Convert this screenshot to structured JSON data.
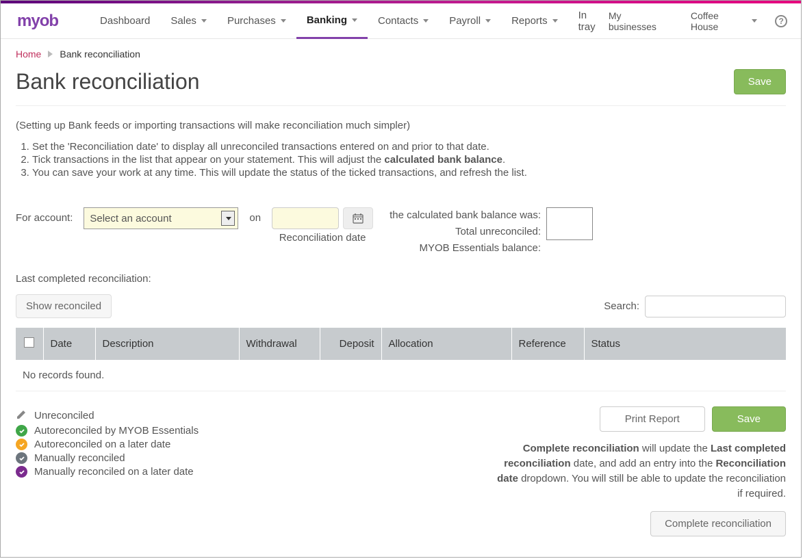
{
  "logo": "myob",
  "nav": {
    "items": [
      {
        "label": "Dashboard",
        "caret": false
      },
      {
        "label": "Sales",
        "caret": true
      },
      {
        "label": "Purchases",
        "caret": true
      },
      {
        "label": "Banking",
        "caret": true,
        "active": true
      },
      {
        "label": "Contacts",
        "caret": true
      },
      {
        "label": "Payroll",
        "caret": true
      },
      {
        "label": "Reports",
        "caret": true
      },
      {
        "label": "In tray",
        "caret": false
      }
    ],
    "right": {
      "businesses": "My businesses",
      "company": "Coffee House"
    }
  },
  "breadcrumb": {
    "home": "Home",
    "current": "Bank reconciliation"
  },
  "page_title": "Bank reconciliation",
  "buttons": {
    "save": "Save",
    "print_report": "Print Report",
    "show_reconciled": "Show reconciled",
    "complete": "Complete reconciliation"
  },
  "intro": "(Setting up Bank feeds or importing transactions will make reconciliation much simpler)",
  "steps": {
    "s1": "Set the 'Reconciliation date' to display all unreconciled transactions entered on and prior to that date.",
    "s2a": "Tick transactions in the list that appear on your statement. This will adjust the ",
    "s2b": "calculated bank balance",
    "s2c": ".",
    "s3": "You can save your work at any time. This will update the status of the ticked transactions, and refresh the list."
  },
  "form": {
    "for_account": "For account:",
    "select_placeholder": "Select an account",
    "on": "on",
    "reconciliation_date": "Reconciliation date",
    "balance_labels": {
      "calculated": "the calculated bank balance was:",
      "unreconciled": "Total unreconciled:",
      "essentials": "MYOB Essentials balance:"
    }
  },
  "last_completed": "Last completed reconciliation:",
  "search_label": "Search:",
  "table": {
    "headers": [
      "",
      "Date",
      "Description",
      "Withdrawal",
      "Deposit",
      "Allocation",
      "Reference",
      "Status"
    ],
    "no_records": "No records found."
  },
  "legend": {
    "unreconciled": "Unreconciled",
    "auto": "Autoreconciled by MYOB Essentials",
    "auto_later": "Autoreconciled on a later date",
    "manual": "Manually reconciled",
    "manual_later": "Manually reconciled on a later date"
  },
  "explain": {
    "p1a": "Complete reconciliation",
    "p1b": " will update the ",
    "p1c": "Last completed reconciliation",
    "p1d": " date, and add an entry into the ",
    "p1e": "Reconciliation date",
    "p1f": " dropdown. You will still be able to update the reconciliation if required."
  },
  "colors": {
    "green": "#3fa648",
    "orange": "#f5a623",
    "grey": "#6c757d",
    "purple": "#7b2b8e"
  }
}
